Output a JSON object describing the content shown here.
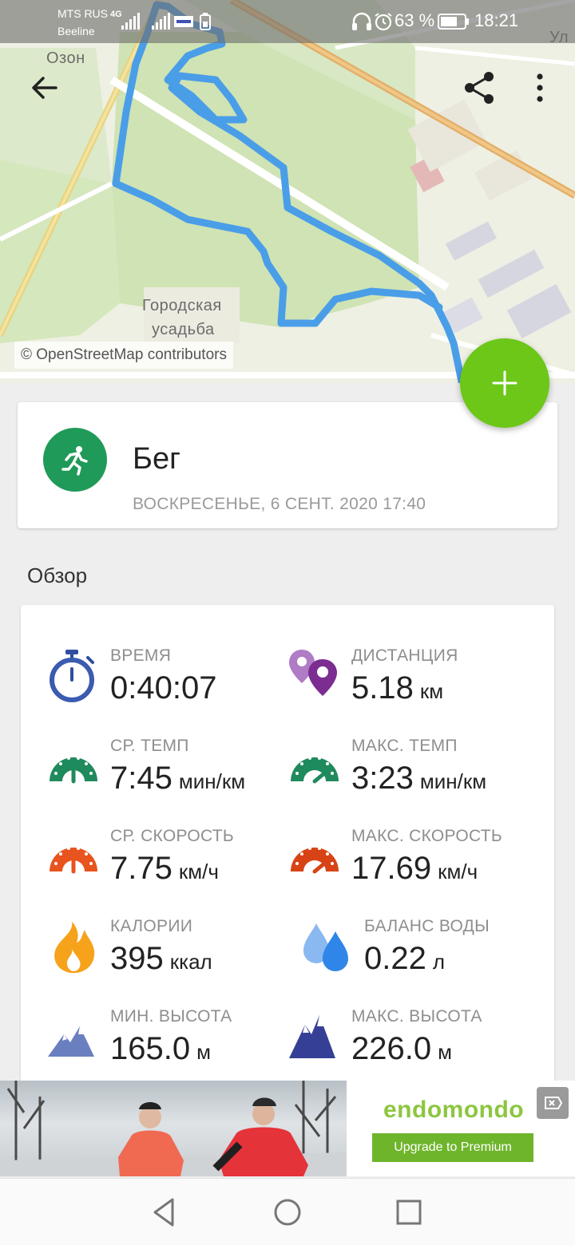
{
  "status_bar": {
    "carrier_primary": "MTS RUS",
    "carrier_secondary": "Beeline",
    "network_type": "4G",
    "battery_percent": "63 %",
    "time": "18:21"
  },
  "map": {
    "labels": {
      "ozon": "Озон",
      "estate_line1": "Городская",
      "estate_line2": "усадьба",
      "street_fragment": "Ул"
    },
    "attribution": "© OpenStreetMap contributors",
    "route_color": "#4a9ee8"
  },
  "toolbar": {
    "back_icon": "arrow-left-icon",
    "share_icon": "share-icon",
    "menu_icon": "more-vert-icon"
  },
  "activity": {
    "sport": "Бег",
    "date": "ВОСКРЕСЕНЬЕ, 6 СЕНТ. 2020 17:40",
    "icon": "running-icon",
    "accent_color": "#1f9a58"
  },
  "fab": {
    "icon": "plus-icon",
    "color": "#6cc718"
  },
  "overview": {
    "title": "Обзор",
    "stats": [
      {
        "id": "time",
        "label": "ВРЕМЯ",
        "value": "0:40:07",
        "unit": "",
        "icon": "stopwatch-icon"
      },
      {
        "id": "distance",
        "label": "ДИСТАНЦИЯ",
        "value": "5.18",
        "unit": "км",
        "icon": "map-pins-icon"
      },
      {
        "id": "avg_pace",
        "label": "СР. ТЕМП",
        "value": "7:45",
        "unit": "мин/км",
        "icon": "pace-gauge-icon"
      },
      {
        "id": "max_pace",
        "label": "МАКС. ТЕМП",
        "value": "3:23",
        "unit": "мин/км",
        "icon": "pace-gauge-max-icon"
      },
      {
        "id": "avg_speed",
        "label": "СР. СКОРОСТЬ",
        "value": "7.75",
        "unit": "км/ч",
        "icon": "speed-gauge-icon"
      },
      {
        "id": "max_speed",
        "label": "МАКС. СКОРОСТЬ",
        "value": "17.69",
        "unit": "км/ч",
        "icon": "speed-gauge-max-icon"
      },
      {
        "id": "calories",
        "label": "КАЛОРИИ",
        "value": "395",
        "unit": "ккал",
        "icon": "flame-icon"
      },
      {
        "id": "water",
        "label": "БАЛАНС ВОДЫ",
        "value": "0.22",
        "unit": "л",
        "icon": "water-drops-icon"
      },
      {
        "id": "min_alt",
        "label": "МИН. ВЫСОТА",
        "value": "165.0",
        "unit": "м",
        "icon": "mountain-icon"
      },
      {
        "id": "max_alt",
        "label": "МАКС. ВЫСОТА",
        "value": "226.0",
        "unit": "м",
        "icon": "mountain-max-icon"
      }
    ]
  },
  "ad": {
    "brand": "endomondo",
    "cta": "Upgrade to Premium",
    "close_icon": "ad-close-icon"
  },
  "nav": {
    "back_icon": "nav-back-icon",
    "home_icon": "nav-home-icon",
    "recents_icon": "nav-recents-icon"
  }
}
